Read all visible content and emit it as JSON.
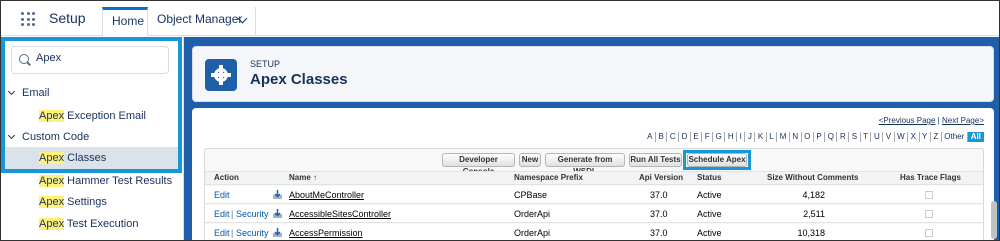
{
  "app": {
    "title": "Setup"
  },
  "tabs": [
    {
      "label": "Home"
    },
    {
      "label": "Object Manager"
    }
  ],
  "sidebar": {
    "search_value": "Apex",
    "groups": [
      {
        "label": "Email",
        "items": [
          {
            "hl": "Apex",
            "rest": " Exception Email"
          }
        ]
      },
      {
        "label": "Custom Code",
        "items": [
          {
            "hl": "Apex",
            "rest": " Classes"
          },
          {
            "hl": "Apex",
            "rest": " Hammer Test Results"
          },
          {
            "hl": "Apex",
            "rest": " Settings"
          },
          {
            "hl": "Apex",
            "rest": " Test Execution"
          }
        ]
      }
    ]
  },
  "header": {
    "setup_label": "SETUP",
    "title": "Apex Classes"
  },
  "pager": {
    "prev": "<Previous Page",
    "separator": " | ",
    "next": "Next Page>"
  },
  "alpha": [
    "A",
    "B",
    "C",
    "D",
    "E",
    "F",
    "G",
    "H",
    "I",
    "J",
    "K",
    "L",
    "M",
    "N",
    "O",
    "P",
    "Q",
    "R",
    "S",
    "T",
    "U",
    "V",
    "W",
    "X",
    "Y",
    "Z",
    "Other",
    "All"
  ],
  "buttons": {
    "developer_console": "Developer Console",
    "new": "New",
    "generate_wsdl": "Generate from WSDL",
    "run_all_tests": "Run All Tests",
    "schedule_apex": "Schedule Apex"
  },
  "table": {
    "headers": {
      "action": "Action",
      "name": "Name ↑",
      "namespace": "Namespace Prefix",
      "api": "Api Version",
      "status": "Status",
      "size": "Size Without Comments",
      "trace": "Has Trace Flags"
    },
    "rows": [
      {
        "action_edit": "Edit",
        "action_security": "",
        "name": "AboutMeController",
        "namespace": "CPBase",
        "api": "37.0",
        "status": "Active",
        "size": "4,182"
      },
      {
        "action_edit": "Edit",
        "action_security": "Security",
        "name": "AccessibleSitesController",
        "namespace": "OrderApi",
        "api": "37.0",
        "status": "Active",
        "size": "2,511"
      },
      {
        "action_edit": "Edit",
        "action_security": "Security",
        "name": "AccessPermission",
        "namespace": "OrderApi",
        "api": "37.0",
        "status": "Active",
        "size": "10,318"
      }
    ]
  },
  "colors": {
    "accent": "#1797d8",
    "brand_blue": "#1f5ea8",
    "highlight": "#fff17b",
    "link": "#015ba7"
  }
}
